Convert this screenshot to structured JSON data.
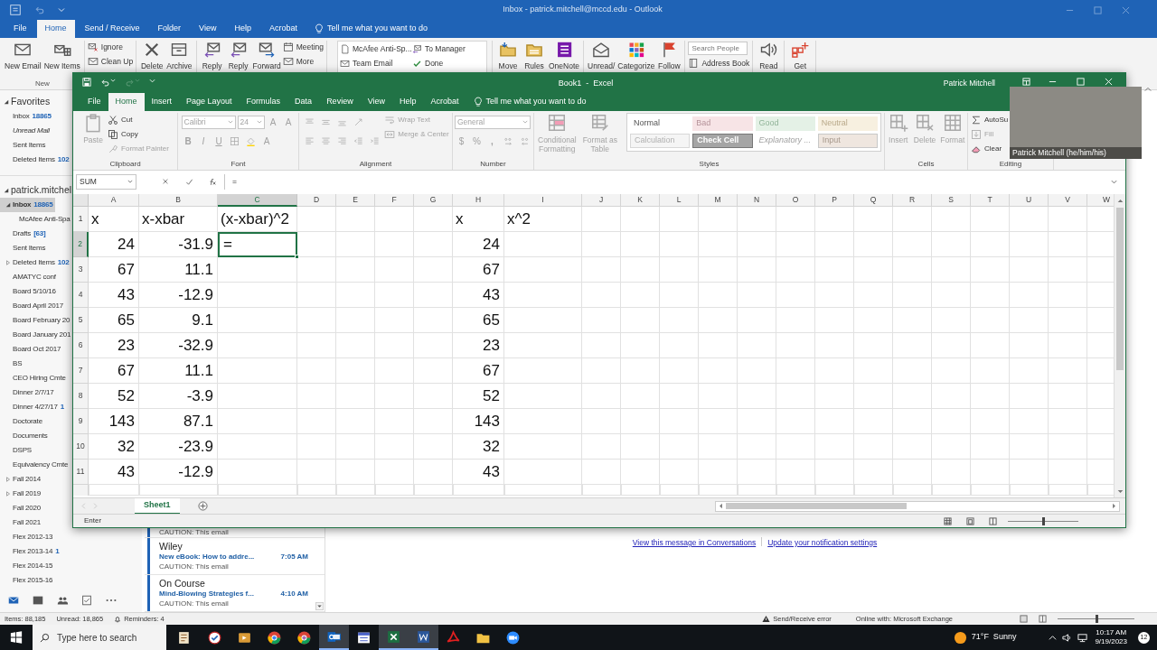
{
  "outlook": {
    "title": "Inbox - patrick.mitchell@mccd.edu - Outlook",
    "tabs": [
      {
        "label": "File",
        "selected": false
      },
      {
        "label": "Home",
        "selected": true
      },
      {
        "label": "Send / Receive",
        "selected": false
      },
      {
        "label": "Folder",
        "selected": false
      },
      {
        "label": "View",
        "selected": false
      },
      {
        "label": "Help",
        "selected": false
      },
      {
        "label": "Acrobat",
        "selected": false
      }
    ],
    "tell_me": "Tell me what you want to do",
    "ribbon": [
      {
        "label": "New",
        "items": [
          {
            "kind": "large",
            "label": "New Email"
          },
          {
            "kind": "large",
            "label": "New Items"
          }
        ]
      },
      {
        "items": [
          {
            "kind": "stack",
            "items": [
              {
                "kind": "small",
                "label": "Ignore"
              },
              {
                "kind": "small",
                "label": "Clean Up"
              }
            ]
          }
        ]
      },
      {
        "items": [
          {
            "kind": "large",
            "label": "Delete"
          },
          {
            "kind": "large",
            "label": "Archive"
          }
        ]
      },
      {
        "items": [
          {
            "kind": "large",
            "label": "Reply"
          },
          {
            "kind": "large",
            "label": "Reply"
          },
          {
            "kind": "large",
            "label": "Forward"
          },
          {
            "kind": "stack",
            "items": [
              {
                "kind": "small",
                "label": "Meeting"
              },
              {
                "kind": "small",
                "label": "More"
              }
            ]
          }
        ]
      },
      {
        "items": [
          {
            "kind": "gallery",
            "items": [
              {
                "label": "McAfee Anti-Sp..."
              },
              {
                "label": "To Manager"
              },
              {
                "label": "Team Email"
              },
              {
                "label": "Done"
              }
            ]
          }
        ]
      },
      {
        "items": [
          {
            "kind": "large",
            "label": "Move"
          },
          {
            "kind": "large",
            "label": "Rules"
          },
          {
            "kind": "large",
            "label": "OneNote"
          }
        ]
      },
      {
        "items": [
          {
            "kind": "large",
            "label": "Unread/"
          },
          {
            "kind": "large",
            "label": "Categorize"
          },
          {
            "kind": "large",
            "label": "Follow"
          }
        ]
      },
      {
        "items": [
          {
            "kind": "stack",
            "items": [
              {
                "kind": "search",
                "placeholder": "Search People"
              },
              {
                "kind": "small",
                "label": "Address Book"
              }
            ]
          }
        ]
      },
      {
        "items": [
          {
            "kind": "large",
            "label": "Read"
          }
        ]
      },
      {
        "items": [
          {
            "kind": "large",
            "label": "Get"
          }
        ]
      }
    ],
    "favorites": {
      "label": "Favorites",
      "expanded": true,
      "items": [
        {
          "name": "Inbox",
          "count": "18865",
          "kind": "folder",
          "selected": false
        },
        {
          "name": "Unread Mail",
          "kind": "search",
          "selected": false
        },
        {
          "name": "Sent Items",
          "kind": "folder",
          "selected": false
        },
        {
          "name": "Deleted Items",
          "count": "102",
          "kind": "folder",
          "selected": false
        }
      ]
    },
    "account": {
      "label": "patrick.mitchel",
      "expanded": true,
      "items": [
        {
          "name": "Inbox",
          "count": "18865",
          "kind": "folder",
          "selected": true,
          "expanded": true,
          "children": [
            {
              "name": "McAfee Anti-Spa",
              "kind": "folder",
              "selected": false
            }
          ]
        },
        {
          "name": "Drafts",
          "count": "[63]",
          "kind": "folder",
          "selected": false
        },
        {
          "name": "Sent Items",
          "kind": "folder",
          "selected": false
        },
        {
          "name": "Deleted Items",
          "count": "102",
          "kind": "folder",
          "selected": false,
          "expanded": false
        },
        {
          "name": "AMATYC conf",
          "kind": "folder",
          "selected": false
        },
        {
          "name": "Board 5/10/16",
          "kind": "folder",
          "selected": false
        },
        {
          "name": "Board April 2017",
          "kind": "folder",
          "selected": false
        },
        {
          "name": "Board February 20",
          "kind": "folder",
          "selected": false
        },
        {
          "name": "Board January 201",
          "kind": "folder",
          "selected": false
        },
        {
          "name": "Board Oct 2017",
          "kind": "folder",
          "selected": false
        },
        {
          "name": "BS",
          "kind": "folder",
          "selected": false
        },
        {
          "name": "CEO Hiring Cmte",
          "kind": "folder",
          "selected": false
        },
        {
          "name": "Dinner 2/7/17",
          "kind": "folder",
          "selected": false
        },
        {
          "name": "Dinner 4/27/17",
          "count": "1",
          "kind": "folder",
          "selected": false
        },
        {
          "name": "Doctorate",
          "kind": "folder",
          "selected": false
        },
        {
          "name": "Documents",
          "kind": "folder",
          "selected": false
        },
        {
          "name": "DSPS",
          "kind": "folder",
          "selected": false
        },
        {
          "name": "Equivalency Cmte",
          "kind": "folder",
          "selected": false
        },
        {
          "name": "Fall 2014",
          "kind": "folder",
          "selected": false,
          "expanded": false
        },
        {
          "name": "Fall 2019",
          "kind": "folder",
          "selected": false,
          "expanded": false
        },
        {
          "name": "Fall 2020",
          "kind": "folder",
          "selected": false
        },
        {
          "name": "Fall 2021",
          "kind": "folder",
          "selected": false
        },
        {
          "name": "Flex 2012-13",
          "kind": "folder",
          "selected": false
        },
        {
          "name": "Flex 2013-14",
          "count": "1",
          "kind": "folder",
          "selected": false
        },
        {
          "name": "Flex 2014-15",
          "kind": "folder",
          "selected": false
        },
        {
          "name": "Flex 2015-16",
          "kind": "folder",
          "selected": false
        }
      ]
    },
    "nav": [
      {
        "selected": true
      },
      {
        "selected": false
      },
      {
        "selected": false
      },
      {
        "selected": false
      },
      {
        "selected": false
      }
    ],
    "messages": [
      {
        "preview": "CAUTION: This email",
        "unread": true
      },
      {
        "sender": "Wiley",
        "subject": "New eBook: How to addre...",
        "time": "7:05 AM",
        "preview": "CAUTION: This email",
        "unread": true
      },
      {
        "sender": "On Course",
        "subject": "Mind-Blowing Strategies f...",
        "time": "4:10 AM",
        "preview": "CAUTION: This email",
        "unread": true
      }
    ],
    "reading_links": [
      "View this message in Conversations",
      "Update your notification settings"
    ],
    "status": {
      "items": "Items: 88,185",
      "unread": "Unread: 18,865",
      "reminders": "Reminders: 4",
      "error": "Send/Receive error",
      "connection": "Online with: Microsoft Exchange",
      "zoom": {
        "level": 0.5
      }
    }
  },
  "excel": {
    "title": "Book1  -  Excel",
    "user": "Patrick Mitchell",
    "tabs": [
      {
        "label": "File",
        "selected": false
      },
      {
        "label": "Home",
        "selected": true
      },
      {
        "label": "Insert",
        "selected": false
      },
      {
        "label": "Page Layout",
        "selected": false
      },
      {
        "label": "Formulas",
        "selected": false
      },
      {
        "label": "Data",
        "selected": false
      },
      {
        "label": "Review",
        "selected": false
      },
      {
        "label": "View",
        "selected": false
      },
      {
        "label": "Help",
        "selected": false
      },
      {
        "label": "Acrobat",
        "selected": false
      }
    ],
    "tell_me": "Tell me what you want to do",
    "ribbon": [
      {
        "label": "Clipboard",
        "columns": [
          [
            {
              "kind": "large",
              "label": "Paste",
              "disabled": true
            }
          ],
          [
            {
              "kind": "small",
              "label": "Cut",
              "disabled": false
            },
            {
              "kind": "small",
              "label": "Copy",
              "disabled": false
            },
            {
              "kind": "small",
              "label": "Format Painter",
              "disabled": true
            }
          ]
        ]
      },
      {
        "label": "Font",
        "columns": [
          [
            {
              "kind": "row",
              "items": [
                {
                  "kind": "field",
                  "label": "Calibri",
                  "disabled": true
                },
                {
                  "kind": "field",
                  "label": "24",
                  "disabled": true
                },
                {
                  "kind": "glyph",
                  "label": "A",
                  "disabled": true
                },
                {
                  "kind": "glyph",
                  "label": "A",
                  "disabled": true
                }
              ]
            },
            {
              "kind": "row",
              "items": [
                {
                  "kind": "bold",
                  "label": "B",
                  "disabled": true
                },
                {
                  "kind": "italic",
                  "label": "I",
                  "disabled": true
                },
                {
                  "kind": "underline",
                  "label": "U",
                  "disabled": true
                },
                {
                  "kind": "icon",
                  "disabled": true
                },
                {
                  "kind": "icon",
                  "disabled": true
                },
                {
                  "kind": "glyph",
                  "label": "A",
                  "disabled": true
                }
              ]
            }
          ]
        ]
      },
      {
        "label": "Alignment",
        "columns": [
          [
            {
              "kind": "row",
              "items": [
                {
                  "kind": "icon",
                  "disabled": true
                },
                {
                  "kind": "icon",
                  "disabled": true
                },
                {
                  "kind": "icon",
                  "disabled": true
                },
                {
                  "kind": "icon",
                  "disabled": true
                }
              ]
            },
            {
              "kind": "row",
              "items": [
                {
                  "kind": "icon",
                  "disabled": true
                },
                {
                  "kind": "icon",
                  "disabled": true
                },
                {
                  "kind": "icon",
                  "disabled": true
                },
                {
                  "kind": "icon",
                  "disabled": true
                },
                {
                  "kind": "icon",
                  "disabled": true
                }
              ]
            }
          ],
          [
            {
              "kind": "small",
              "label": "Wrap Text",
              "disabled": true
            },
            {
              "kind": "small",
              "label": "Merge & Center",
              "disabled": true
            }
          ]
        ]
      },
      {
        "label": "Number",
        "columns": [
          [
            {
              "kind": "row",
              "items": [
                {
                  "kind": "field",
                  "label": "General",
                  "disabled": true
                }
              ]
            },
            {
              "kind": "row",
              "items": [
                {
                  "kind": "glyph",
                  "label": "$",
                  "disabled": true
                },
                {
                  "kind": "glyph",
                  "label": "%",
                  "disabled": true
                },
                {
                  "kind": "bold",
                  "label": ",",
                  "disabled": true
                },
                {
                  "kind": "icon",
                  "disabled": true
                },
                {
                  "kind": "icon",
                  "disabled": true
                }
              ]
            }
          ]
        ]
      },
      {
        "label": "Styles",
        "columns": [
          [
            {
              "kind": "large",
              "label": "Conditional Formatting",
              "disabled": true
            }
          ],
          [
            {
              "kind": "large",
              "label": "Format as Table",
              "disabled": true
            }
          ],
          [
            {
              "kind": "gallery",
              "items": [
                {
                  "label": "Normal",
                  "kind": "normal"
                },
                {
                  "label": "Bad",
                  "kind": "bad"
                },
                {
                  "label": "Good",
                  "kind": "good"
                },
                {
                  "label": "Neutral",
                  "kind": "neutral"
                },
                {
                  "label": "Calculation",
                  "kind": "calculation"
                },
                {
                  "label": "Check Cell",
                  "kind": "check"
                },
                {
                  "label": "Explanatory ...",
                  "kind": "explanatory"
                },
                {
                  "label": "Input",
                  "kind": "input"
                }
              ]
            }
          ]
        ]
      },
      {
        "label": "Cells",
        "columns": [
          [
            {
              "kind": "large",
              "label": "Insert",
              "disabled": true
            }
          ],
          [
            {
              "kind": "large",
              "label": "Delete",
              "disabled": true
            }
          ],
          [
            {
              "kind": "large",
              "label": "Format",
              "disabled": true
            }
          ]
        ]
      },
      {
        "label": "Editing",
        "columns": [
          [
            {
              "kind": "small",
              "label": "AutoSu",
              "disabled": false
            },
            {
              "kind": "small",
              "label": "Fill",
              "disabled": true
            },
            {
              "kind": "small",
              "label": "Clear",
              "disabled": false
            }
          ]
        ]
      }
    ],
    "name_box": "SUM",
    "formula": "=",
    "columns": [
      {
        "label": "A",
        "selected": false
      },
      {
        "label": "B",
        "selected": false
      },
      {
        "label": "C",
        "selected": true
      },
      {
        "label": "D",
        "selected": false
      },
      {
        "label": "E",
        "selected": false
      },
      {
        "label": "F",
        "selected": false
      },
      {
        "label": "G",
        "selected": false
      },
      {
        "label": "H",
        "selected": false
      },
      {
        "label": "I",
        "selected": false
      },
      {
        "label": "J",
        "selected": false
      },
      {
        "label": "K",
        "selected": false
      },
      {
        "label": "L",
        "selected": false
      },
      {
        "label": "M",
        "selected": false
      },
      {
        "label": "N",
        "selected": false
      },
      {
        "label": "O",
        "selected": false
      },
      {
        "label": "P",
        "selected": false
      },
      {
        "label": "Q",
        "selected": false
      },
      {
        "label": "R",
        "selected": false
      },
      {
        "label": "S",
        "selected": false
      },
      {
        "label": "T",
        "selected": false
      },
      {
        "label": "U",
        "selected": false
      },
      {
        "label": "V",
        "selected": false
      },
      {
        "label": "W",
        "selected": false
      }
    ],
    "rows": [
      {
        "header": "1",
        "kind": "label",
        "selected": false,
        "cells": {
          "a": "x",
          "b": "x-xbar",
          "c": "(x-xbar)^2",
          "h": "x",
          "i": "x^2"
        }
      },
      {
        "header": "2",
        "kind": "number",
        "selected": true,
        "cells": {
          "a": "24",
          "b": "-31.9",
          "c": "=",
          "h": "24"
        }
      },
      {
        "header": "3",
        "kind": "number",
        "selected": false,
        "cells": {
          "a": "67",
          "b": "11.1",
          "h": "67"
        }
      },
      {
        "header": "4",
        "kind": "number",
        "selected": false,
        "cells": {
          "a": "43",
          "b": "-12.9",
          "h": "43"
        }
      },
      {
        "header": "5",
        "kind": "number",
        "selected": false,
        "cells": {
          "a": "65",
          "b": "9.1",
          "h": "65"
        }
      },
      {
        "header": "6",
        "kind": "number",
        "selected": false,
        "cells": {
          "a": "23",
          "b": "-32.9",
          "h": "23"
        }
      },
      {
        "header": "7",
        "kind": "number",
        "selected": false,
        "cells": {
          "a": "67",
          "b": "11.1",
          "h": "67"
        }
      },
      {
        "header": "8",
        "kind": "number",
        "selected": false,
        "cells": {
          "a": "52",
          "b": "-3.9",
          "h": "52"
        }
      },
      {
        "header": "9",
        "kind": "number",
        "selected": false,
        "cells": {
          "a": "143",
          "b": "87.1",
          "h": "143"
        }
      },
      {
        "header": "10",
        "kind": "number",
        "selected": false,
        "cells": {
          "a": "32",
          "b": "-23.9",
          "h": "32"
        }
      },
      {
        "header": "11",
        "kind": "number",
        "selected": false,
        "cells": {
          "a": "43",
          "b": "-12.9",
          "h": "43"
        }
      }
    ],
    "sheets": [
      {
        "label": "Sheet1",
        "selected": true
      }
    ],
    "status": "Enter",
    "zoom": {
      "level": 0.5
    }
  },
  "webcam": {
    "caption": "Patrick Mitchell (he/him/his)"
  },
  "taskbar": {
    "search_placeholder": "Type here to search",
    "apps": [
      {
        "active": false
      },
      {
        "active": false
      },
      {
        "active": false
      },
      {
        "active": false
      },
      {
        "active": false
      },
      {
        "active": true
      },
      {
        "active": false
      },
      {
        "active": true
      },
      {
        "active": true
      },
      {
        "active": false
      },
      {
        "active": false
      },
      {
        "active": false
      }
    ],
    "weather": "71°F  Sunny",
    "time": "10:17 AM",
    "date": "9/19/2023",
    "notifications": "12"
  }
}
